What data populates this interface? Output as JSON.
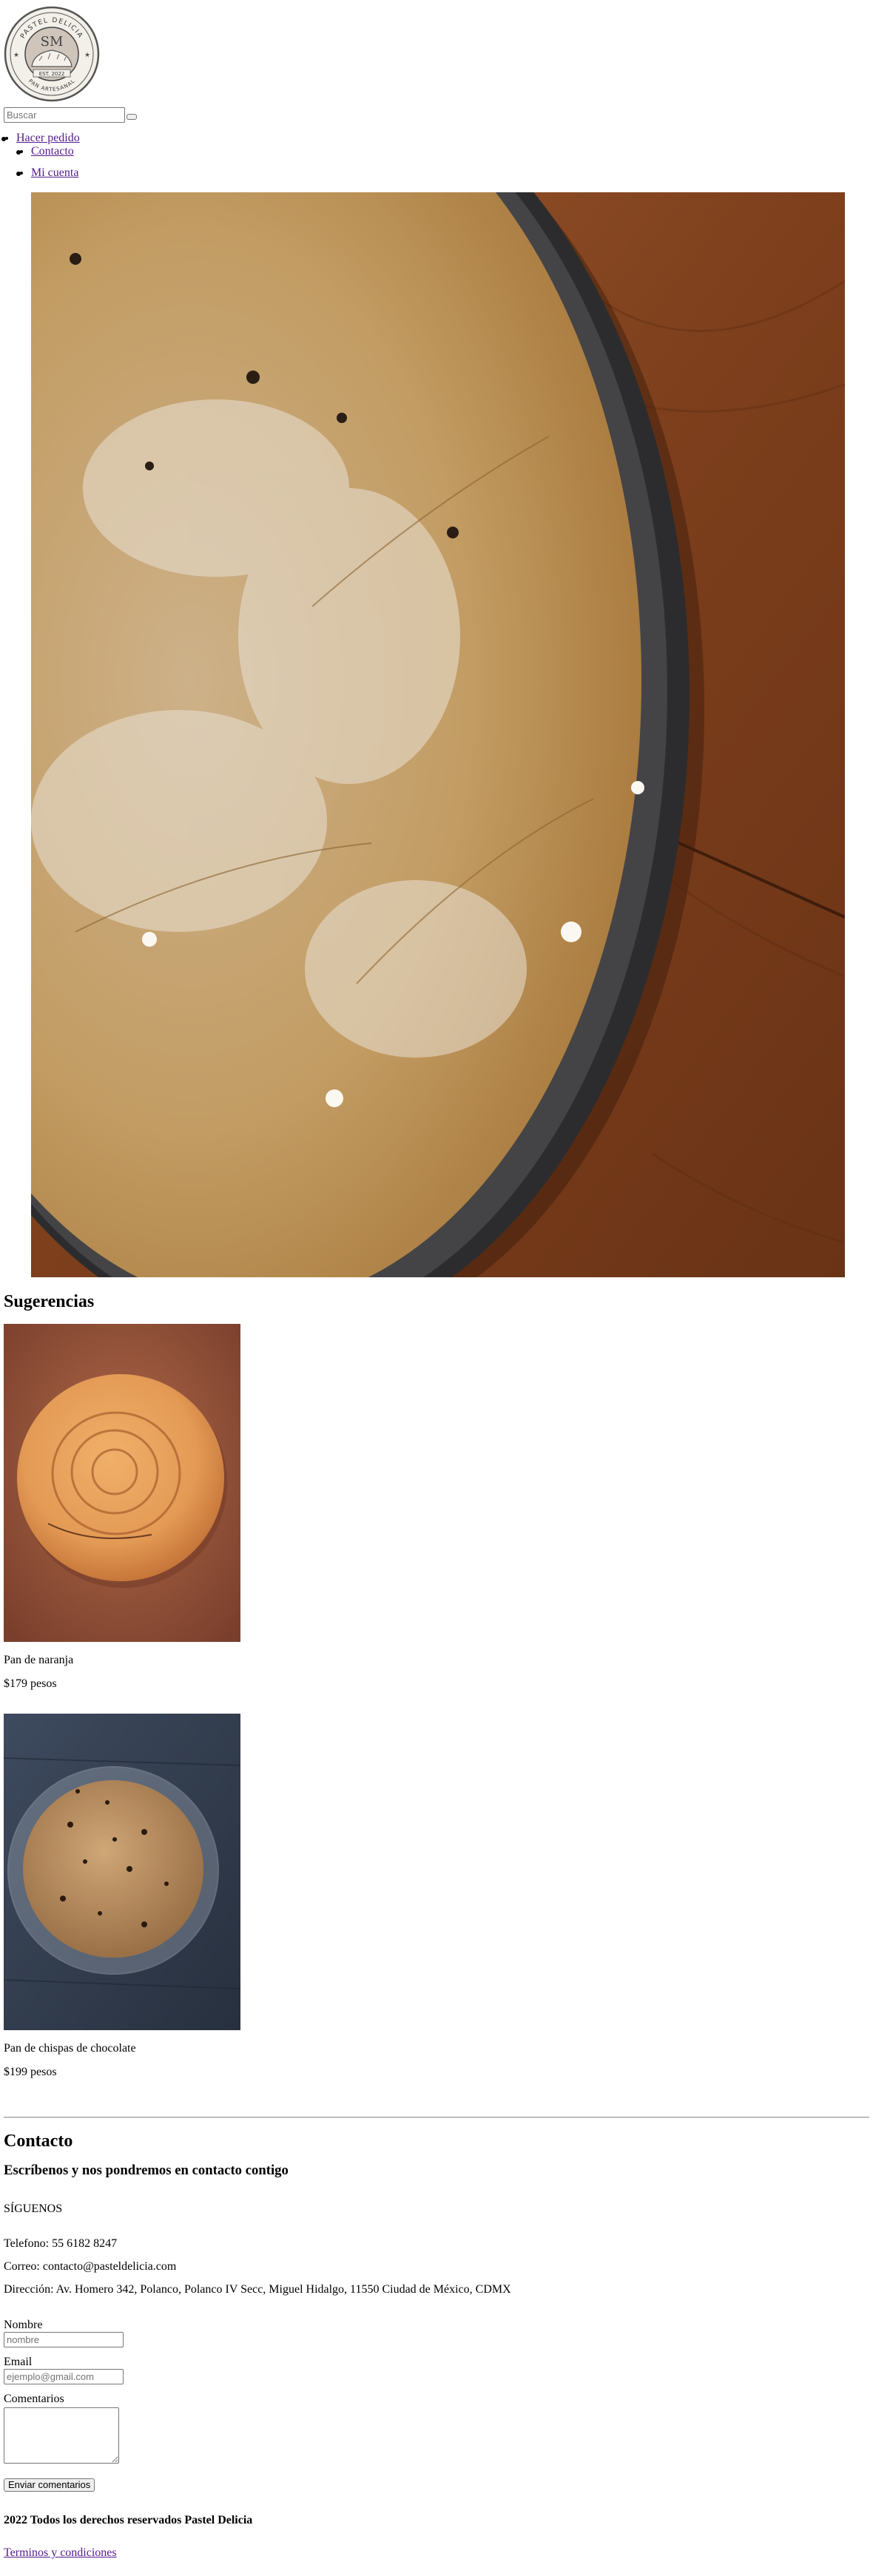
{
  "logo": {
    "top_text": "PASTEL DELICIA",
    "monogram": "SM",
    "est": "EST. 2022",
    "bottom_text": "PAN ARTESANAL"
  },
  "search": {
    "placeholder": "Buscar",
    "value": ""
  },
  "nav": {
    "items": [
      "Hacer pedido",
      "Contacto"
    ],
    "account": "Mi cuenta"
  },
  "suggestions": {
    "heading": "Sugerencias",
    "products": [
      {
        "name": "Pan de naranja",
        "price": "$179 pesos"
      },
      {
        "name": "Pan de chispas de chocolate",
        "price": "$199 pesos"
      }
    ]
  },
  "contact": {
    "heading": "Contacto",
    "subheading": "Escríbenos y nos pondremos en contacto contigo",
    "follow": "SÍGUENOS",
    "phone": "Telefono: 55 6182 8247",
    "email": "Correo: contacto@pasteldelicia.com",
    "address": "Dirección: Av. Homero 342, Polanco, Polanco IV Secc, Miguel Hidalgo, 11550 Ciudad de México, CDMX"
  },
  "form": {
    "name_label": "Nombre",
    "name_placeholder": "nombre",
    "email_label": "Email",
    "email_placeholder": "ejemplo@gmail.com",
    "comments_label": "Comentarios",
    "submit_label": "Enviar comentarios"
  },
  "footer": {
    "copyright": "2022 Todos los derechos reservados Pastel Delicia",
    "terms": "Terminos y condiciones"
  },
  "colors": {
    "link": "#551a8b",
    "wood": "#8a4a22",
    "bread": "#c8a46a"
  }
}
